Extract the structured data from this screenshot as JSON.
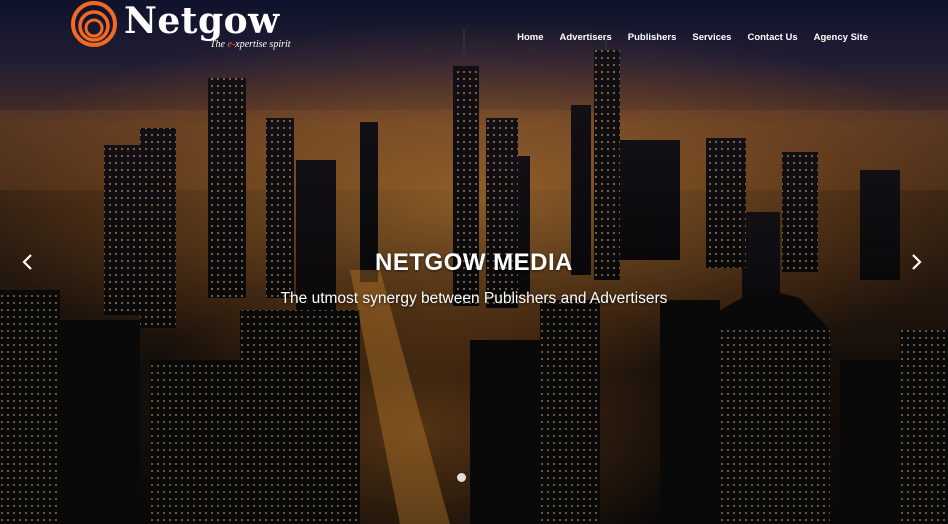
{
  "brand": {
    "name": "Netgow",
    "tagline_prefix": "The ",
    "tagline_highlight": "e-",
    "tagline_suffix": "xpertise spirit",
    "accent_color": "#f26a21"
  },
  "nav": {
    "items": [
      {
        "label": "Home"
      },
      {
        "label": "Advertisers"
      },
      {
        "label": "Publishers"
      },
      {
        "label": "Services"
      },
      {
        "label": "Contact Us"
      },
      {
        "label": "Agency Site"
      }
    ]
  },
  "hero": {
    "title": "NETGOW MEDIA",
    "subtitle": "The utmost synergy between Publishers and Advertisers",
    "prev_icon": "chevron-left-icon",
    "next_icon": "chevron-right-icon",
    "slide_count": 1,
    "active_slide": 1
  }
}
